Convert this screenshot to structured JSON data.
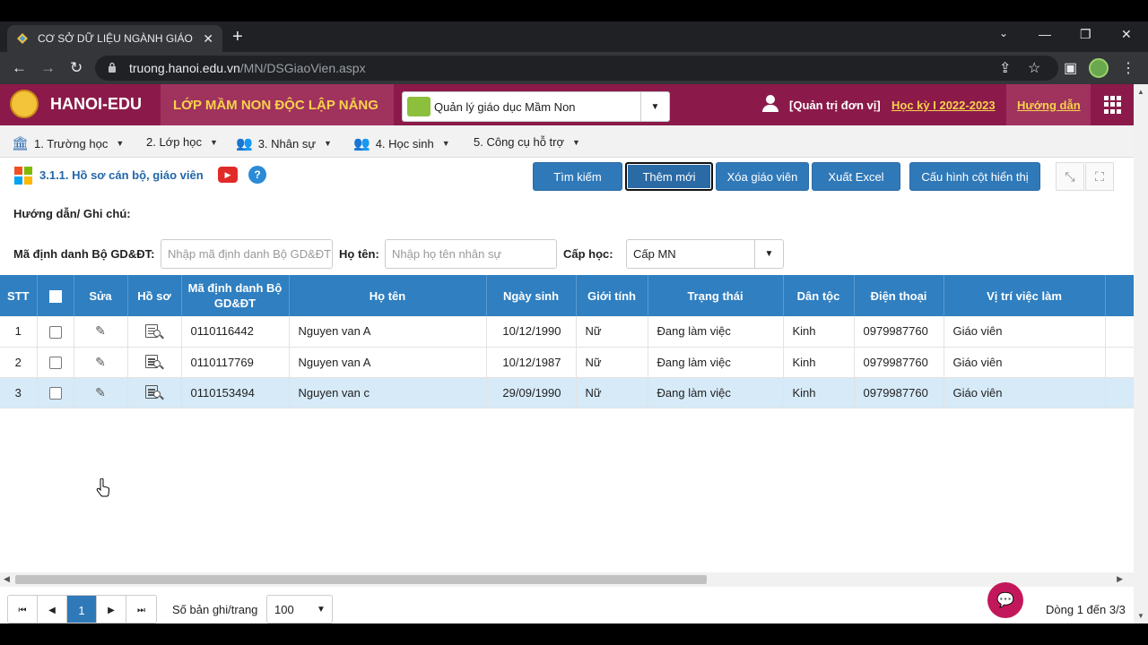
{
  "browser": {
    "tab_title": "CƠ SỞ DỮ LIỆU NGÀNH GIÁO DỤ",
    "url_host": "truong.hanoi.edu.vn",
    "url_path": "/MN/DSGiaoVien.aspx"
  },
  "header": {
    "brand": "HANOI-EDU",
    "school": "LỚP MẦM NON ĐỘC LẬP NẮNG",
    "module": "Quản lý giáo dục Mầm Non",
    "role": "[Quản trị đơn vị]",
    "term": "Học kỳ I 2022-2023",
    "help": "Hướng dẫn"
  },
  "menu": [
    {
      "label": "1. Trường học",
      "icon": "school-icon"
    },
    {
      "label": "2. Lớp học",
      "icon": ""
    },
    {
      "label": "3. Nhân sự",
      "icon": "staff-icon"
    },
    {
      "label": "4. Học sinh",
      "icon": "students-icon"
    },
    {
      "label": "5. Công cụ hỗ trợ",
      "icon": ""
    }
  ],
  "toolbar": {
    "heading": "3.1.1. Hồ sơ cán bộ, giáo viên",
    "search": "Tìm kiếm",
    "add": "Thêm mới",
    "delete": "Xóa giáo viên",
    "export": "Xuất Excel",
    "config": "Cấu hình cột hiển thị"
  },
  "note_label": "Hướng dẫn/ Ghi chú:",
  "filters": {
    "id_label": "Mã định danh Bộ GD&ĐT:",
    "id_placeholder": "Nhập mã định danh Bộ GD&ĐT",
    "name_label": "Họ tên:",
    "name_placeholder": "Nhập họ tên nhân sự",
    "level_label": "Cấp học:",
    "level_value": "Cấp MN"
  },
  "table": {
    "headers": {
      "stt": "STT",
      "edit": "Sửa",
      "profile": "Hồ sơ",
      "id_line1": "Mã định danh Bộ",
      "id_line2": "GD&ĐT",
      "name": "Họ tên",
      "dob": "Ngày sinh",
      "gender": "Giới tính",
      "status": "Trạng thái",
      "ethnicity": "Dân tộc",
      "phone": "Điện thoại",
      "position": "Vị trí việc làm"
    },
    "rows": [
      {
        "stt": "1",
        "id": "0110116442",
        "name": "Nguyen van A",
        "dob": "10/12/1990",
        "gender": "Nữ",
        "status": "Đang làm việc",
        "ethnicity": "Kinh",
        "phone": "0979987760",
        "position": "Giáo viên"
      },
      {
        "stt": "2",
        "id": "0110117769",
        "name": "Nguyen van A",
        "dob": "10/12/1987",
        "gender": "Nữ",
        "status": "Đang làm việc",
        "ethnicity": "Kinh",
        "phone": "0979987760",
        "position": "Giáo viên"
      },
      {
        "stt": "3",
        "id": "0110153494",
        "name": "Nguyen van c",
        "dob": "29/09/1990",
        "gender": "Nữ",
        "status": "Đang làm việc",
        "ethnicity": "Kinh",
        "phone": "0979987760",
        "position": "Giáo viên"
      }
    ],
    "selected_row": 3
  },
  "pager": {
    "current_page": "1",
    "rpp_label": "Số bản ghi/trang",
    "rpp_value": "100",
    "range": "Dòng 1 đến 3/3"
  }
}
